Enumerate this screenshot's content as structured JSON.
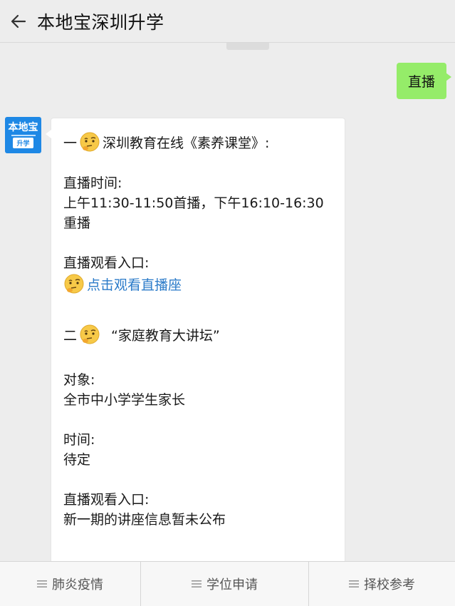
{
  "header": {
    "title": "本地宝深圳升学",
    "back_icon": "back-arrow-icon"
  },
  "chat": {
    "outgoing_message": "直播",
    "avatar": {
      "top_text": "本地宝",
      "bottom_text": "升学"
    },
    "incoming": {
      "section1_prefix": "一",
      "section1_title": "深圳教育在线《素养课堂》:",
      "live_time_label": "直播时间:",
      "live_time_line1": "上午11:30-11:50首播，下午16:10-16:30",
      "live_time_line2": "重播",
      "entry_label_1": "直播观看入口:",
      "entry_link": "点击观看直播座",
      "section2_prefix": "二",
      "section2_title": "“家庭教育大讲坛”",
      "audience_label": "对象:",
      "audience_value": "全市中小学学生家长",
      "time_label": "时间:",
      "time_value": "待定",
      "entry_label_2": "直播观看入口:",
      "entry_value_2": "新一期的讲座信息暂未公布",
      "emoji_icon": "thinking-face-emoji"
    }
  },
  "bottom_menu": [
    {
      "label": "肺炎疫情",
      "icon": "menu-lines-icon"
    },
    {
      "label": "学位申请",
      "icon": "menu-lines-icon"
    },
    {
      "label": "择校参考",
      "icon": "menu-lines-icon"
    }
  ],
  "colors": {
    "background": "#ededed",
    "outgoing_bubble": "#95ec69",
    "link": "#2b7bc9",
    "avatar_brand": "#1e88e5"
  }
}
